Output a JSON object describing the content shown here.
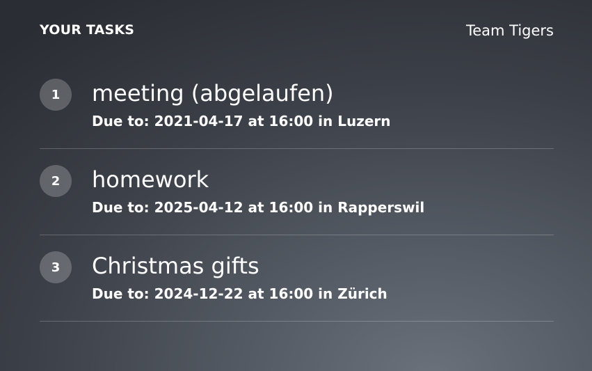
{
  "header": {
    "title": "YOUR TASKS",
    "team": "Team Tigers"
  },
  "tasks": [
    {
      "number": "1",
      "title": "meeting (abgelaufen)",
      "due": "Due to: 2021-04-17 at 16:00 in Luzern"
    },
    {
      "number": "2",
      "title": "homework",
      "due": "Due to: 2025-04-12 at 16:00 in Rapperswil"
    },
    {
      "number": "3",
      "title": "Christmas gifts",
      "due": "Due to: 2024-12-22 at 16:00 in Zürich"
    }
  ]
}
